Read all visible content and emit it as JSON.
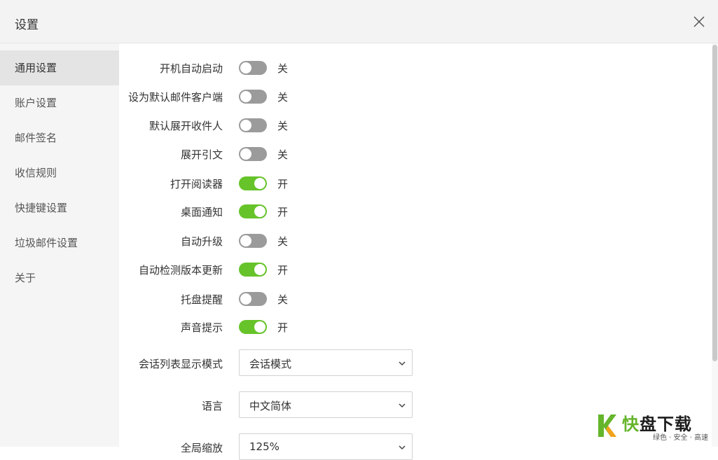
{
  "window": {
    "title": "设置"
  },
  "sidebar": {
    "items": [
      {
        "label": "通用设置",
        "active": true
      },
      {
        "label": "账户设置",
        "active": false
      },
      {
        "label": "邮件签名",
        "active": false
      },
      {
        "label": "收信规则",
        "active": false
      },
      {
        "label": "快捷键设置",
        "active": false
      },
      {
        "label": "垃圾邮件设置",
        "active": false
      },
      {
        "label": "关于",
        "active": false
      }
    ]
  },
  "settings": {
    "toggles": [
      {
        "label": "开机自动启动",
        "on": false,
        "state": "关"
      },
      {
        "label": "设为默认邮件客户端",
        "on": false,
        "state": "关"
      },
      {
        "label": "默认展开收件人",
        "on": false,
        "state": "关"
      },
      {
        "label": "展开引文",
        "on": false,
        "state": "关"
      },
      {
        "label": "打开阅读器",
        "on": true,
        "state": "开"
      },
      {
        "label": "桌面通知",
        "on": true,
        "state": "开"
      },
      {
        "label": "自动升级",
        "on": false,
        "state": "关"
      },
      {
        "label": "自动检测版本更新",
        "on": true,
        "state": "开"
      },
      {
        "label": "托盘提醒",
        "on": false,
        "state": "关"
      },
      {
        "label": "声音提示",
        "on": true,
        "state": "开"
      }
    ],
    "selects": [
      {
        "label": "会话列表显示模式",
        "value": "会话模式"
      },
      {
        "label": "语言",
        "value": "中文简体"
      },
      {
        "label": "全局缩放",
        "value": "125%"
      }
    ]
  },
  "watermark": {
    "brand_first": "快",
    "brand_rest": "盘下载",
    "tagline": "绿色 · 安全 · 高速"
  },
  "colors": {
    "toggle_on": "#66c329",
    "toggle_off": "#9b9b9b",
    "brand_green": "#65b52b"
  }
}
